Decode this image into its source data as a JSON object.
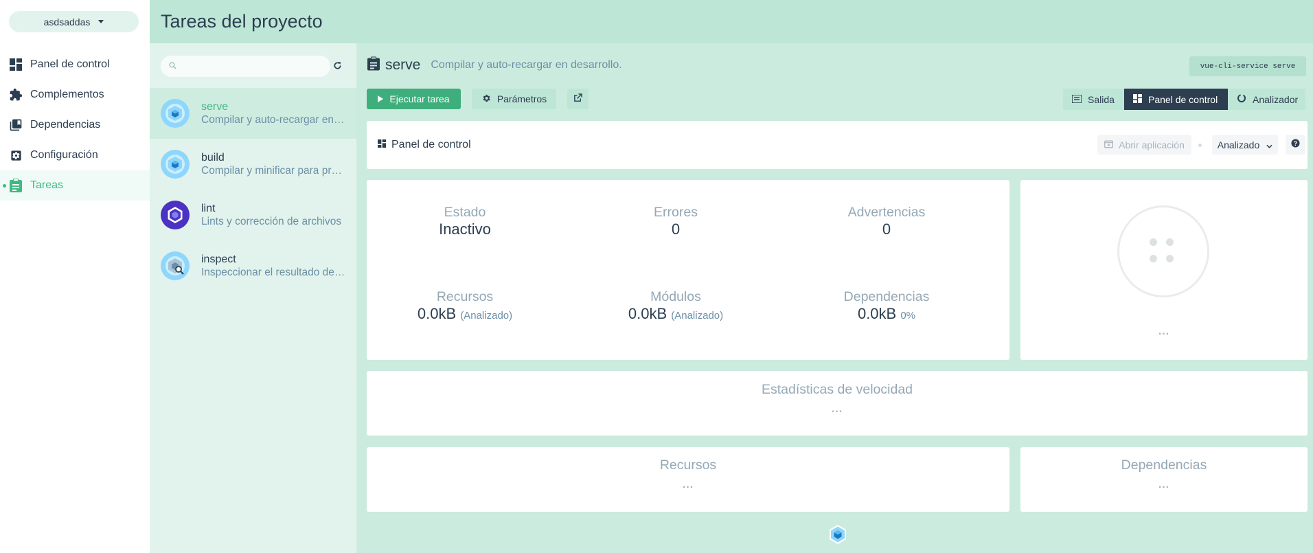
{
  "nav": {
    "project": "asdsaddas",
    "items": [
      {
        "label": "Panel de control",
        "icon": "dashboard-icon"
      },
      {
        "label": "Complementos",
        "icon": "puzzle-icon"
      },
      {
        "label": "Dependencias",
        "icon": "library-books-icon"
      },
      {
        "label": "Configuración",
        "icon": "settings-icon"
      },
      {
        "label": "Tareas",
        "icon": "assignment-icon",
        "active": true
      }
    ]
  },
  "header": {
    "title": "Tareas del proyecto"
  },
  "tasklist": {
    "search_placeholder": "",
    "tasks": [
      {
        "name": "serve",
        "description": "Compilar y auto-recargar en desarrollo.",
        "icon": "webpack-icon",
        "selected": true
      },
      {
        "name": "build",
        "description": "Compilar y minificar para producción",
        "icon": "webpack-icon"
      },
      {
        "name": "lint",
        "description": "Lints y corrección de archivos",
        "icon": "eslint-icon"
      },
      {
        "name": "inspect",
        "description": "Inspeccionar el resultado de la configuración",
        "icon": "webpack-inspect-icon"
      }
    ]
  },
  "task": {
    "name": "serve",
    "description": "Compilar y auto-recargar en desarrollo.",
    "command": "vue-cli-service serve"
  },
  "toolbar": {
    "run_label": "Ejecutar tarea",
    "params_label": "Parámetros",
    "views": {
      "output": "Salida",
      "dashboard": "Panel de control",
      "analyzer": "Analizador"
    }
  },
  "dashboard": {
    "title": "Panel de control",
    "open_app": "Abrir aplicación",
    "mode": "Analizado"
  },
  "stats": {
    "status": {
      "label": "Estado",
      "value": "Inactivo"
    },
    "errors": {
      "label": "Errores",
      "value": "0"
    },
    "warnings": {
      "label": "Advertencias",
      "value": "0"
    },
    "assets": {
      "label": "Recursos",
      "value": "0.0kB",
      "unit": "(Analizado)"
    },
    "modules": {
      "label": "Módulos",
      "value": "0.0kB",
      "unit": "(Analizado)"
    },
    "dependencies": {
      "label": "Dependencias",
      "value": "0.0kB",
      "unit": "0%"
    }
  },
  "progress": {
    "placeholder": "..."
  },
  "speed": {
    "title": "Estadísticas de velocidad",
    "placeholder": "..."
  },
  "assets_card": {
    "title": "Recursos",
    "placeholder": "..."
  },
  "deps_card": {
    "title": "Dependencias",
    "placeholder": "..."
  },
  "colors": {
    "accent": "#42b983",
    "header": "#bde6d7",
    "dark": "#2c3e50"
  }
}
